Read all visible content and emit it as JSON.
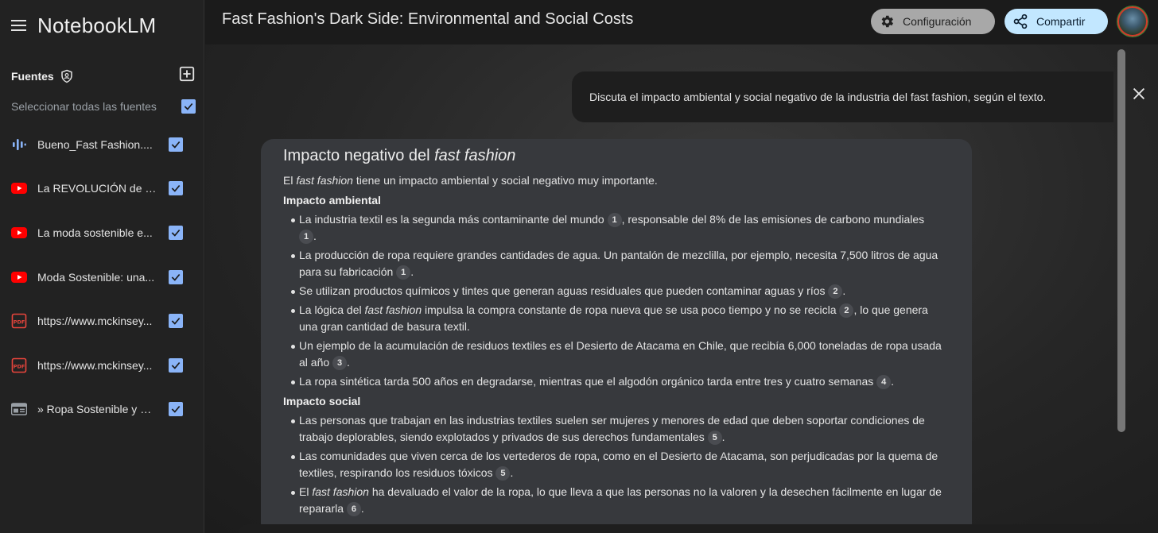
{
  "app": {
    "name": "NotebookLM"
  },
  "notebook": {
    "title": "Fast Fashion's Dark Side: Environmental and Social Costs"
  },
  "toolbar": {
    "config_label": "Configuración",
    "share_label": "Compartir"
  },
  "sidebar": {
    "sources_title": "Fuentes",
    "select_all_label": "Seleccionar todas las fuentes",
    "items": [
      {
        "label": "Bueno_Fast Fashion....",
        "icon": "audio-icon"
      },
      {
        "label": "La REVOLUCIÓN de l...",
        "icon": "youtube-icon"
      },
      {
        "label": "La moda sostenible e...",
        "icon": "youtube-icon"
      },
      {
        "label": "Moda Sostenible: una...",
        "icon": "youtube-icon"
      },
      {
        "label": "https://www.mckinsey...",
        "icon": "pdf-icon"
      },
      {
        "label": "https://www.mckinsey...",
        "icon": "pdf-icon"
      },
      {
        "label": "» Ropa Sostenible y E...",
        "icon": "web-icon"
      }
    ]
  },
  "chat": {
    "user_message": "Discuta el impacto ambiental y social negativo de la industria del fast fashion, según el texto.",
    "answer": {
      "title_prefix": "Impacto negativo del ",
      "title_em": "fast fashion",
      "intro_pre": "El ",
      "intro_em": "fast fashion",
      "intro_post": " tiene un impacto ambiental y social negativo muy importante.",
      "env_heading": "Impacto ambiental",
      "env": {
        "b1": "La industria textil es la segunda más contaminante del mundo",
        "b1c1": "1",
        "b1_mid": ", responsable del 8% de las emisiones de carbono mundiales",
        "b1c2": "1",
        "b2": "La producción de ropa requiere grandes cantidades de agua. Un pantalón de mezclilla, por ejemplo, necesita 7,500 litros de agua para su fabricación",
        "b2c": "1",
        "b3": "Se utilizan productos químicos y tintes que generan aguas residuales que pueden contaminar aguas y ríos",
        "b3c": "2",
        "b4_pre": "La lógica del ",
        "b4_em": "fast fashion",
        "b4_mid": " impulsa la compra constante de ropa nueva que se usa poco tiempo y no se recicla",
        "b4c": "2",
        "b4_post": ", lo que genera una gran cantidad de basura textil.",
        "b5": "Un ejemplo de la acumulación de residuos textiles es el Desierto de Atacama en Chile, que recibía 6,000 toneladas de ropa usada al año",
        "b5c": "3",
        "b6": "La ropa sintética tarda 500 años en degradarse, mientras que el algodón orgánico tarda entre tres y cuatro semanas",
        "b6c": "4"
      },
      "soc_heading": "Impacto social",
      "soc": {
        "b1": "Las personas que trabajan en las industrias textiles suelen ser mujeres y menores de edad que deben soportar condiciones de trabajo deplorables, siendo explotados y privados de sus derechos fundamentales",
        "b1c": "5",
        "b2": "Las comunidades que viven cerca de los vertederos de ropa, como en el Desierto de Atacama, son perjudicadas por la quema de textiles, respirando los residuos tóxicos",
        "b2c": "5",
        "b3_pre": "El ",
        "b3_em": "fast fashion",
        "b3_post": " ha devaluado el valor de la ropa, lo que lleva a que las personas no la valoren y la desechen fácilmente en lugar de repararla",
        "b3c": "6"
      }
    }
  },
  "colors": {
    "accent": "#8ab4f8",
    "youtube": "#ff0000",
    "share_bg": "#c2e7ff",
    "config_bg": "#a8a8a8"
  }
}
